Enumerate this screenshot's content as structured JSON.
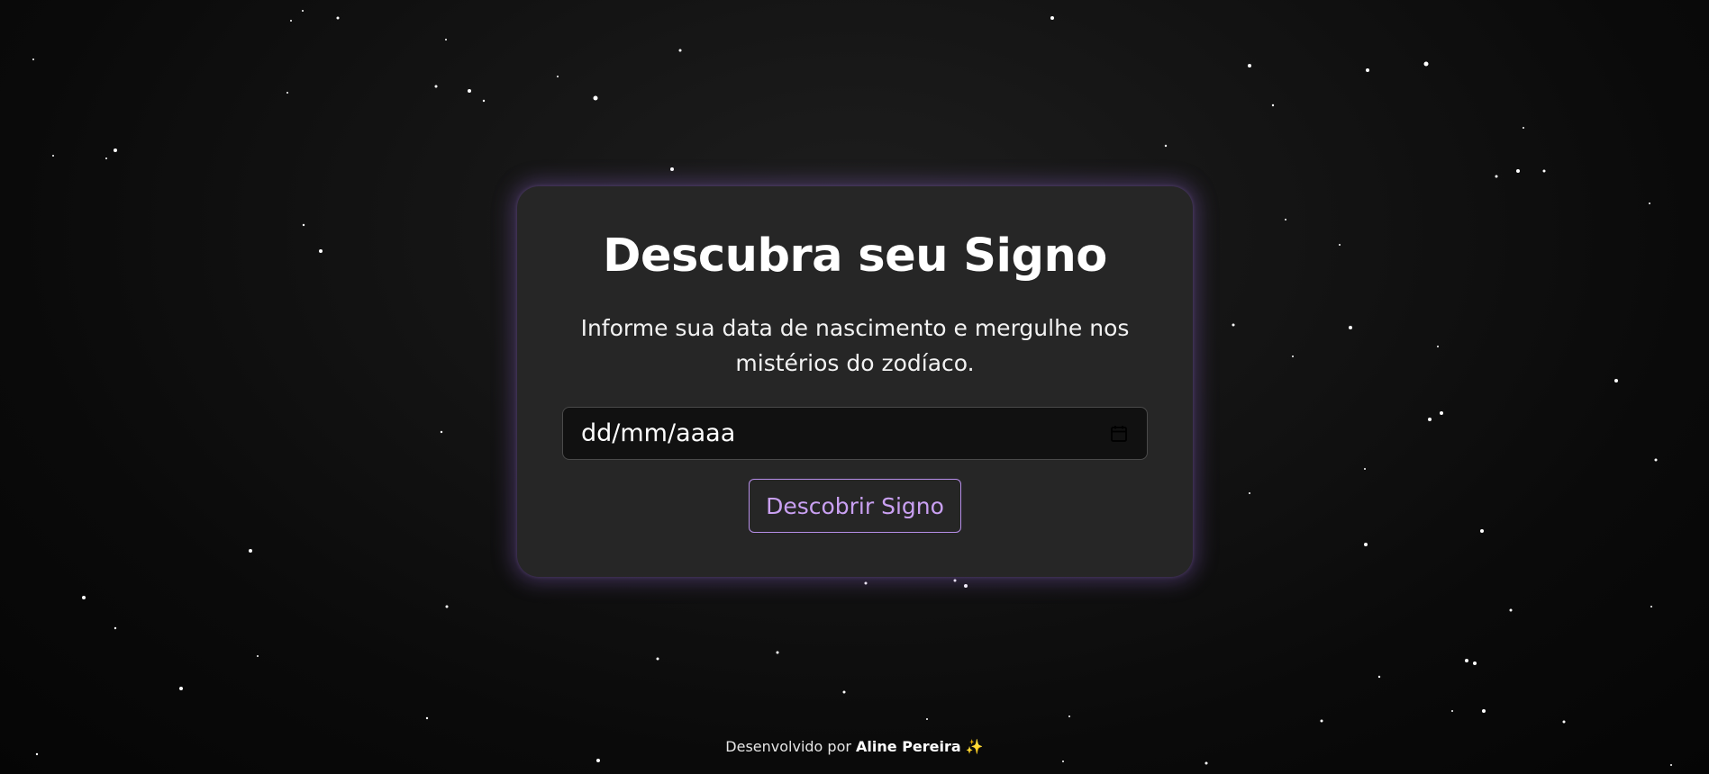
{
  "card": {
    "title": "Descubra seu Signo",
    "subtitle": "Informe sua data de nascimento e mergulhe nos mistérios do zodíaco.",
    "date_input": {
      "placeholder": "dd/mm/aaaa",
      "icon": "calendar-icon"
    },
    "button_label": "Descobrir Signo"
  },
  "footer": {
    "prefix": "Desenvolvido por",
    "author": "Aline Pereira",
    "emoji": "✨"
  },
  "colors": {
    "background": "#0b0b0b",
    "card": "#262626",
    "accent": "#b68ee8",
    "glow": "#8c64c8"
  }
}
